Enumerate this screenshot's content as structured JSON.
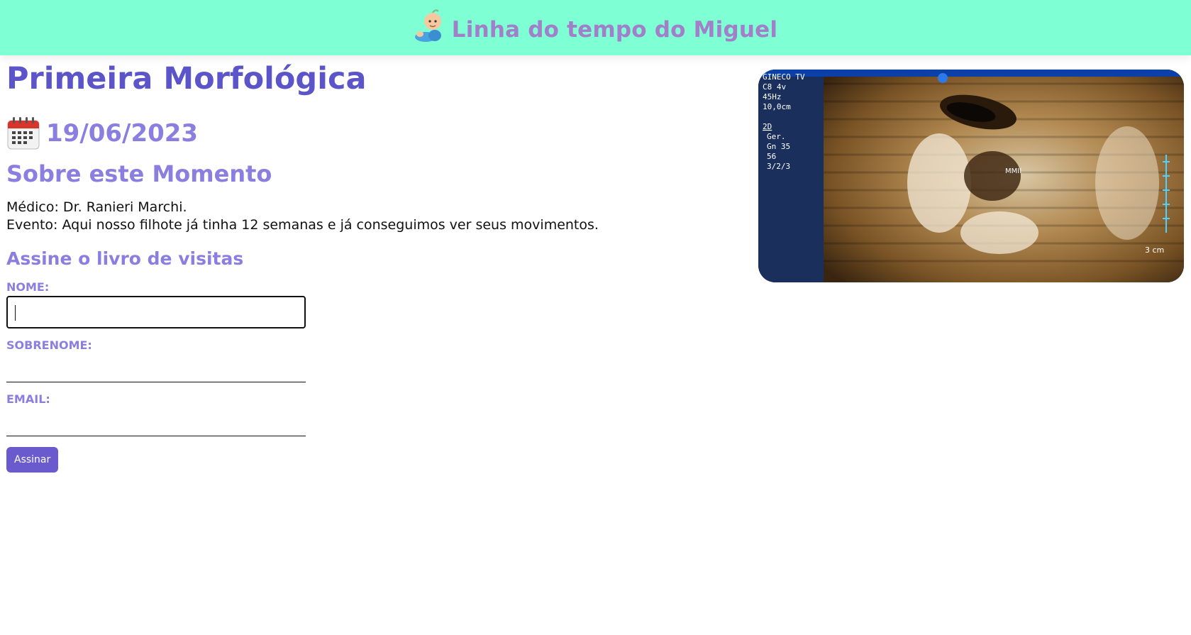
{
  "header": {
    "brand_title": "Linha do tempo do Miguel",
    "brand_icon": "baby-icon"
  },
  "moment": {
    "title": "Primeira Morfológica",
    "date_icon": "calendar-icon",
    "date": "19/06/2023",
    "about_title": "Sobre este Momento",
    "doctor_line": "Médico: Dr. Ranieri Marchi.",
    "event_line": "Evento: Aqui nosso filhote já tinha 12 semanas e já conseguimos ver seus movimentos."
  },
  "guestbook": {
    "title": "Assine o livro de visitas",
    "name_label": "NOME:",
    "name_value": "",
    "surname_label": "SOBRENOME:",
    "surname_value": "",
    "email_label": "EMAIL:",
    "email_value": "",
    "submit_label": "Assinar"
  },
  "ultrasound": {
    "overlay_lines": [
      "GINECO TV",
      "C8 4v",
      "45Hz",
      "10,0cm",
      "2D",
      "Ger.",
      "Gn 35",
      "56",
      "3/2/3"
    ],
    "mark": "MMII",
    "scale": "3 cm"
  },
  "colors": {
    "header_bg": "#7fffd4",
    "brand": "#a17fc9",
    "title": "#5b55c9",
    "accent": "#8a7fe0",
    "button": "#6a5acd"
  }
}
